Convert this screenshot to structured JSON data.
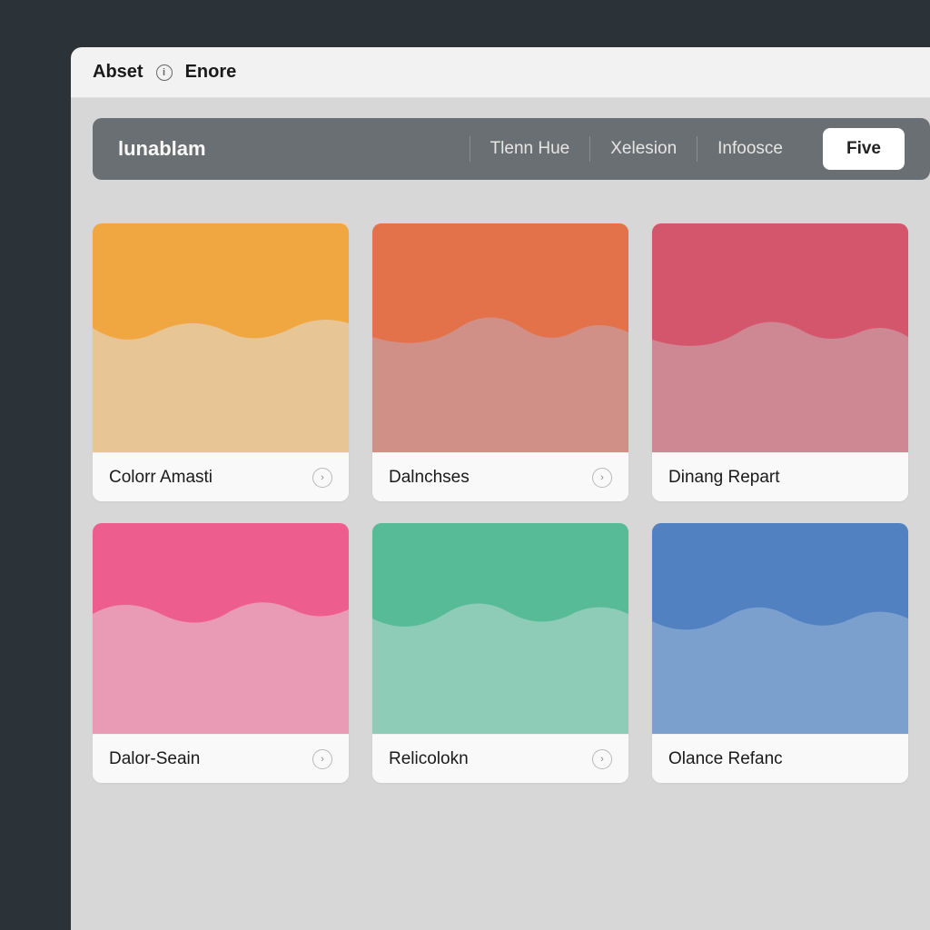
{
  "titlebar": {
    "label1": "Abset",
    "label2": "Enore"
  },
  "toolbar": {
    "brand": "lunablam",
    "tabs": [
      "Tlenn Hue",
      "Xelesion",
      "Infoosce"
    ],
    "button": "Five"
  },
  "cards": [
    {
      "title": "Colorr Amasti",
      "colors": {
        "top": "#f0a742",
        "bottom": "#e8c594"
      }
    },
    {
      "title": "Dalnchses",
      "colors": {
        "top": "#e3714a",
        "bottom": "#d19087"
      }
    },
    {
      "title": "Dinang Repart",
      "colors": {
        "top": "#d4566c",
        "bottom": "#cd8893"
      }
    },
    {
      "title": "Dalor-Seain",
      "colors": {
        "top": "#ed5e8e",
        "bottom": "#e99bb5"
      }
    },
    {
      "title": "Relicolokn",
      "colors": {
        "top": "#57bb98",
        "bottom": "#8fccb8"
      }
    },
    {
      "title": "Olance Refanc",
      "colors": {
        "top": "#5281c2",
        "bottom": "#7ba0ce"
      }
    }
  ]
}
